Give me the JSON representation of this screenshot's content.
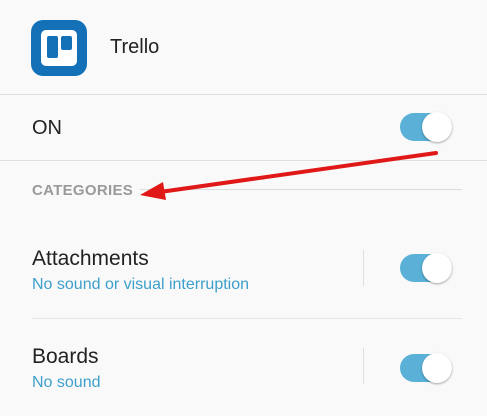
{
  "app": {
    "name": "Trello",
    "brand_color": "#1471b8",
    "icon": "trello-logo-icon"
  },
  "master_toggle": {
    "label": "ON",
    "state": true
  },
  "categories": {
    "header": "CATEGORIES",
    "items": [
      {
        "title": "Attachments",
        "subtitle": "No sound or visual interruption",
        "enabled": true
      },
      {
        "title": "Boards",
        "subtitle": "No sound",
        "enabled": true
      }
    ]
  },
  "colors": {
    "toggle_on": "#5ab0d6",
    "subtitle": "#3d9fcb",
    "annotation_arrow": "#e01818"
  }
}
